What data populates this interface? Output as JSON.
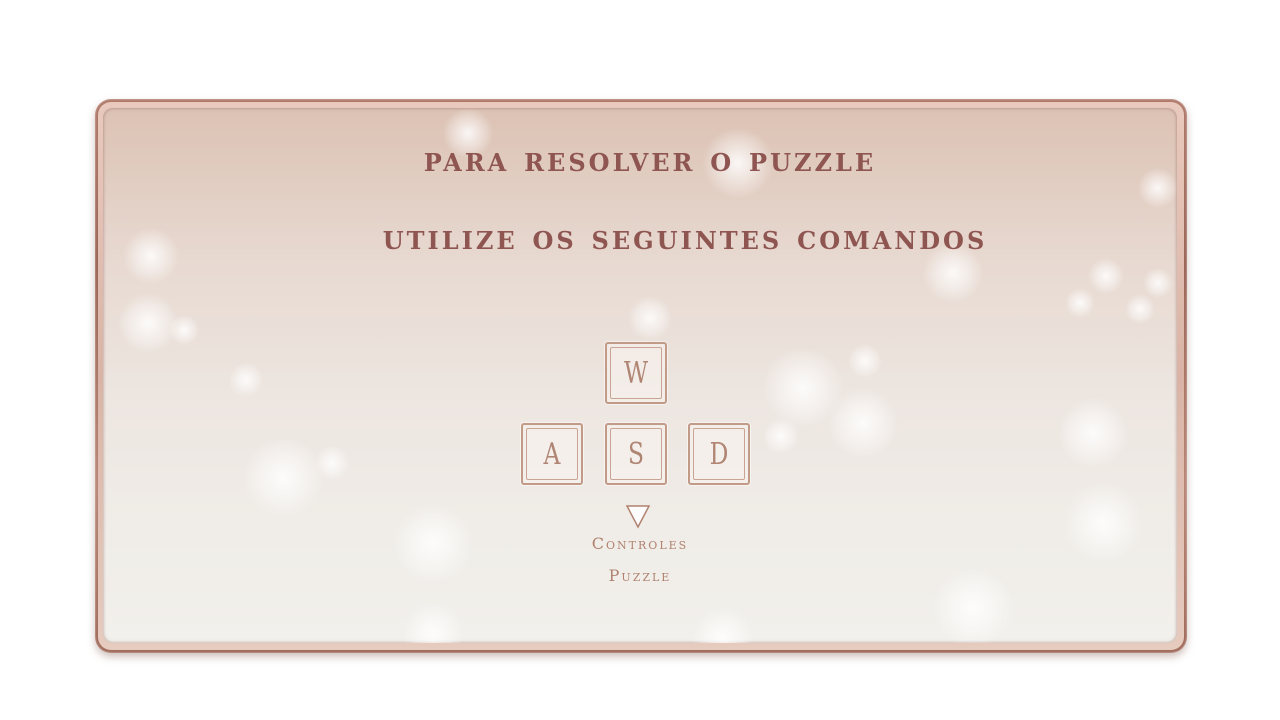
{
  "instructions": {
    "line1": "PARA RESOLVER O PUZZLE",
    "line2": "UTILIZE OS SEGUINTES COMANDOS"
  },
  "keys": {
    "up": "W",
    "left": "A",
    "down": "S",
    "right": "D"
  },
  "footer": {
    "caption_line1": "Controles",
    "caption_line2": "Puzzle"
  },
  "icons": {
    "indicator": "triangle-down-icon"
  },
  "colors": {
    "title_text": "#8e5551",
    "key_text": "#b08574",
    "frame": "#9a6455"
  }
}
